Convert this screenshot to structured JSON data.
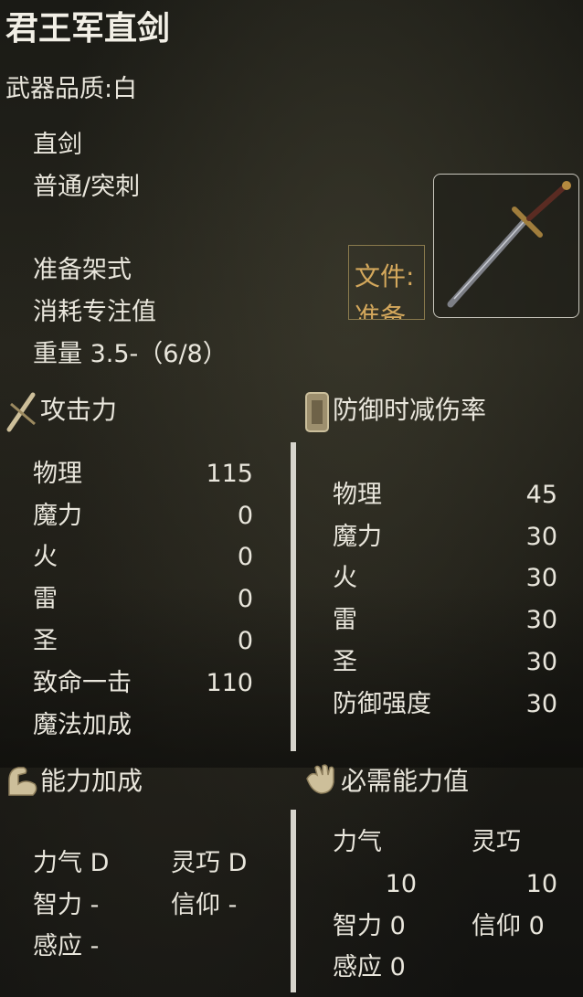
{
  "weapon": {
    "name": "君王军直剑",
    "quality": "武器品质:白",
    "type": "直剑",
    "attack_type": "普通/突刺",
    "skill_name": "准备架式",
    "focus_cost_label": "消耗专注值",
    "weight": "重量  3.5-（6/8）",
    "file_label_1": "文件:",
    "file_label_2": "准备"
  },
  "sections": {
    "attack": "攻击力",
    "defense": "防御时减伤率",
    "scaling": "能力加成",
    "requirements": "必需能力值"
  },
  "attack": [
    {
      "label": "物理",
      "value": "115"
    },
    {
      "label": "魔力",
      "value": "0"
    },
    {
      "label": "火",
      "value": "0"
    },
    {
      "label": "雷",
      "value": "0"
    },
    {
      "label": "圣",
      "value": "0"
    },
    {
      "label": "致命一击",
      "value": "110"
    },
    {
      "label": "魔法加成",
      "value": ""
    }
  ],
  "defense": [
    {
      "label": "物理",
      "value": "45"
    },
    {
      "label": "魔力",
      "value": "30"
    },
    {
      "label": "火",
      "value": "30"
    },
    {
      "label": "雷",
      "value": "30"
    },
    {
      "label": "圣",
      "value": "30"
    },
    {
      "label": "防御强度",
      "value": "30"
    }
  ],
  "scaling": {
    "str": "力气 D",
    "dex": "灵巧 D",
    "int": "智力  -",
    "fai": "信仰  -",
    "arc": "感应  -"
  },
  "requirements": {
    "str_label": "力气",
    "dex_label": "灵巧",
    "str_value": "10",
    "dex_value": "10",
    "int": "智力 0",
    "fai": "信仰  0",
    "arc": "感应  0"
  },
  "icons": {
    "attack": "sword-icon",
    "defense": "shield-icon",
    "scaling": "flexed-arm-icon",
    "requirements": "open-hand-icon"
  }
}
